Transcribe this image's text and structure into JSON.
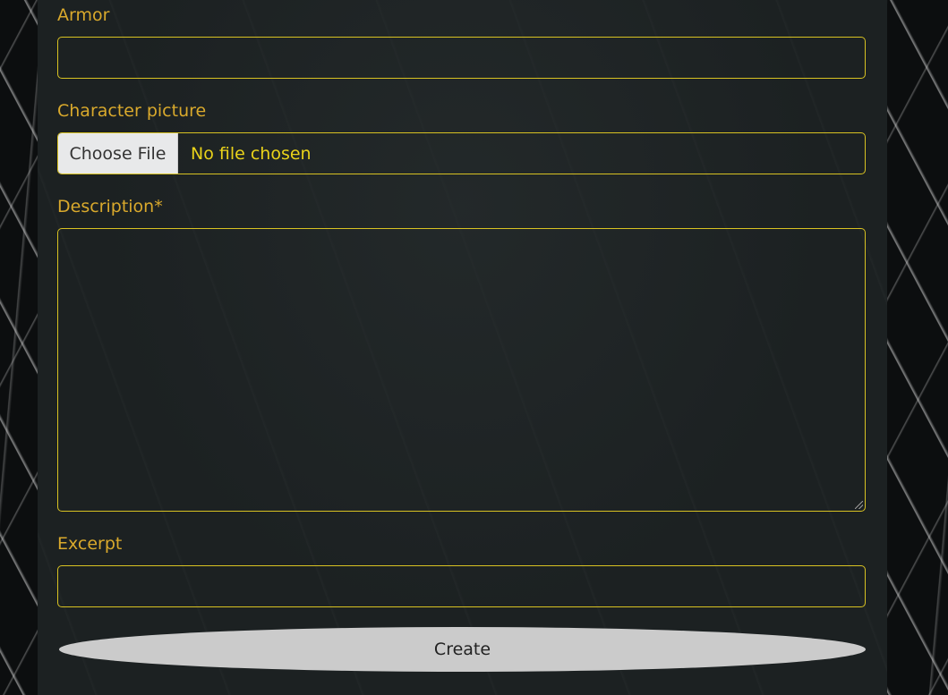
{
  "form": {
    "armor_label": "Armor",
    "armor_value": "",
    "picture_label": "Character picture",
    "choose_file_label": "Choose File",
    "file_status": "No file chosen",
    "description_label": "Description*",
    "description_value": "",
    "excerpt_label": "Excerpt",
    "excerpt_value": "",
    "submit_label": "Create"
  },
  "colors": {
    "label": "#d9a92c",
    "field_border": "#d8c222",
    "file_status_text": "#e9d21a",
    "panel_bg": "#1c2122",
    "button_bg": "#cbcbcb"
  }
}
